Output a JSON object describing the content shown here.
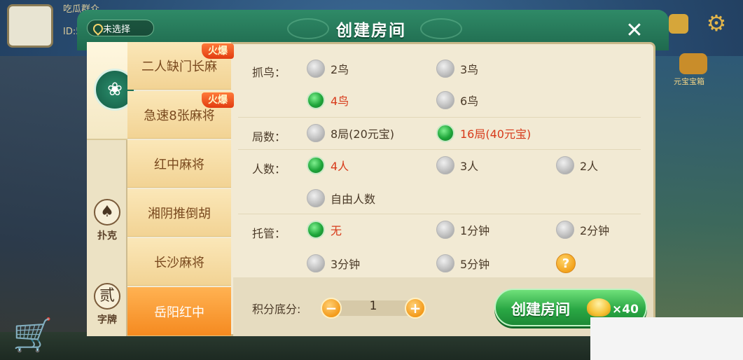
{
  "background": {
    "player_name": "吃瓜群众",
    "player_id": "ID:5",
    "treasure_label": "元宝宝箱",
    "shop_hint": "商城"
  },
  "header": {
    "location": "未选择",
    "title": "创建房间",
    "close_glyph": "✕"
  },
  "categories": [
    {
      "id": "mahjong",
      "label": "",
      "icon": "mahjong-tile-icon",
      "glyph": "❀",
      "active": true
    },
    {
      "id": "poker",
      "label": "扑克",
      "icon": "spade-icon",
      "glyph": "♠",
      "active": false
    },
    {
      "id": "zipai",
      "label": "字牌",
      "icon": "zipai-icon",
      "glyph": "贰",
      "active": false
    }
  ],
  "game_tabs": [
    {
      "label": "二人缺门长麻",
      "hot": "火爆",
      "active": false
    },
    {
      "label": "急速8张麻将",
      "hot": "火爆",
      "active": false
    },
    {
      "label": "红中麻将",
      "hot": "",
      "active": false
    },
    {
      "label": "湘阴推倒胡",
      "hot": "",
      "active": false
    },
    {
      "label": "长沙麻将",
      "hot": "",
      "active": false
    },
    {
      "label": "岳阳红中",
      "hot": "",
      "active": true
    }
  ],
  "options": {
    "birds": {
      "label": "抓鸟：",
      "choices": [
        {
          "label": "2鸟",
          "selected": false
        },
        {
          "label": "3鸟",
          "selected": false
        },
        {
          "label": "4鸟",
          "selected": true
        },
        {
          "label": "6鸟",
          "selected": false
        }
      ]
    },
    "rounds": {
      "label": "局数：",
      "choices": [
        {
          "label": "8局(20元宝)",
          "selected": false
        },
        {
          "label": "16局(40元宝)",
          "selected": true
        }
      ]
    },
    "players": {
      "label": "人数：",
      "choices": [
        {
          "label": "4人",
          "selected": true
        },
        {
          "label": "3人",
          "selected": false
        },
        {
          "label": "2人",
          "selected": false
        },
        {
          "label": "自由人数",
          "selected": false
        }
      ]
    },
    "trustee": {
      "label": "托管：",
      "choices": [
        {
          "label": "无",
          "selected": true
        },
        {
          "label": "1分钟",
          "selected": false
        },
        {
          "label": "2分钟",
          "selected": false
        },
        {
          "label": "3分钟",
          "selected": false
        },
        {
          "label": "5分钟",
          "selected": false
        }
      ],
      "help": "?"
    }
  },
  "footer": {
    "score_label": "积分底分:",
    "score_value": "1",
    "minus": "−",
    "plus": "+",
    "create_label": "创建房间",
    "cost": "×40"
  },
  "colors": {
    "header_green": "#1f6a4e",
    "selected_text": "#d73a1a",
    "active_tab": "#f58a20",
    "create_green": "#2aa844"
  }
}
